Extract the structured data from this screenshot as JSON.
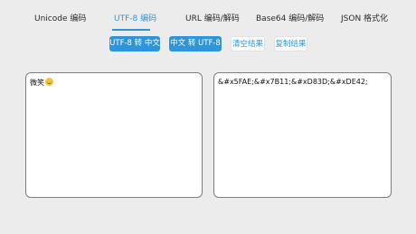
{
  "tabs": [
    {
      "label": "Unicode 编码"
    },
    {
      "label": "UTF-8 编码"
    },
    {
      "label": "URL 编码/解码"
    },
    {
      "label": "Base64 编码/解码"
    },
    {
      "label": "JSON 格式化"
    }
  ],
  "active_tab_index": 1,
  "actions": {
    "utf8_to_cn": "UTF-8 转 中文",
    "cn_to_utf8": "中文 转 UTF-8",
    "clear": "清空结果",
    "copy": "复制结果"
  },
  "input": {
    "text": "微笑",
    "emoji_icon": "smiling-face-icon"
  },
  "output": {
    "text": "&#x5FAE;&#x7B11;&#xD83D;&#xDE42;"
  },
  "colors": {
    "accent": "#2f95d8",
    "background": "#ececec"
  }
}
